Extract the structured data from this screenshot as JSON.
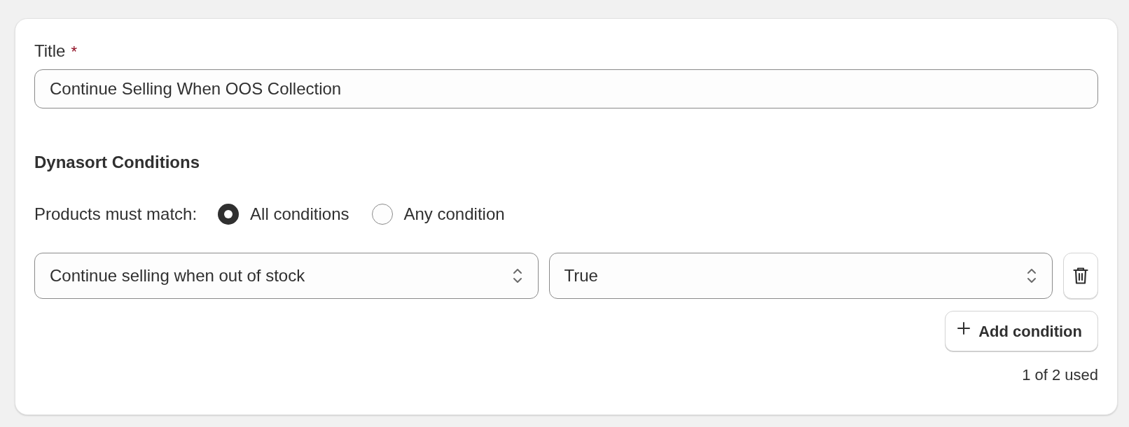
{
  "title_field": {
    "label": "Title",
    "required_mark": "*",
    "value": "Continue Selling When OOS Collection"
  },
  "conditions_section": {
    "heading": "Dynasort Conditions",
    "match_label": "Products must match:",
    "match_options": [
      {
        "label": "All conditions",
        "selected": true
      },
      {
        "label": "Any condition",
        "selected": false
      }
    ],
    "conditions": [
      {
        "field": "Continue selling when out of stock",
        "value": "True"
      }
    ],
    "add_button": "Add condition",
    "usage": "1 of 2 used"
  }
}
